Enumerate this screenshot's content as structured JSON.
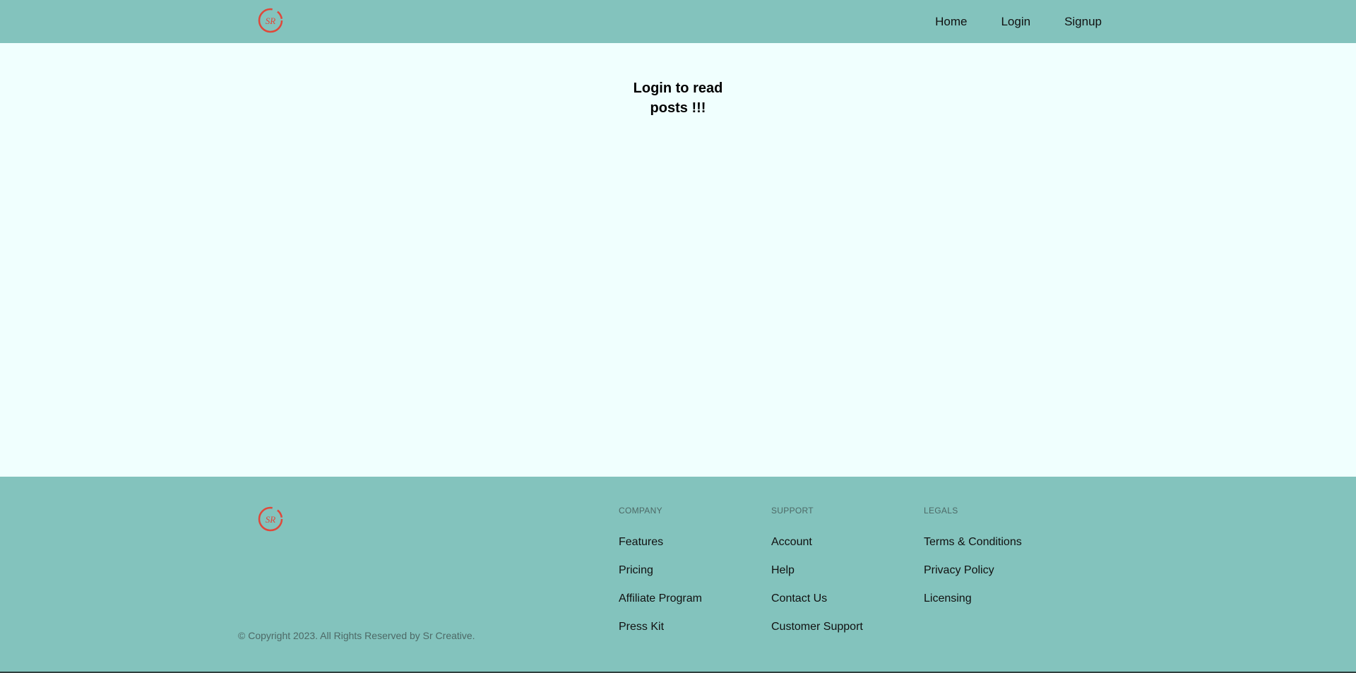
{
  "header": {
    "logo_text": "SR",
    "nav": [
      {
        "label": "Home"
      },
      {
        "label": "Login"
      },
      {
        "label": "Signup"
      }
    ]
  },
  "main": {
    "heading": "Login to read posts !!!"
  },
  "footer": {
    "logo_text": "SR",
    "copyright": "© Copyright 2023. All Rights Reserved by Sr Creative.",
    "columns": [
      {
        "title": "COMPANY",
        "links": [
          "Features",
          "Pricing",
          "Affiliate Program",
          "Press Kit"
        ]
      },
      {
        "title": "SUPPORT",
        "links": [
          "Account",
          "Help",
          "Contact Us",
          "Customer Support"
        ]
      },
      {
        "title": "LEGALS",
        "links": [
          "Terms & Conditions",
          "Privacy Policy",
          "Licensing"
        ]
      }
    ]
  },
  "colors": {
    "header_bg": "#83c3bd",
    "page_bg": "#f0fffe",
    "logo": "#e0483a"
  }
}
